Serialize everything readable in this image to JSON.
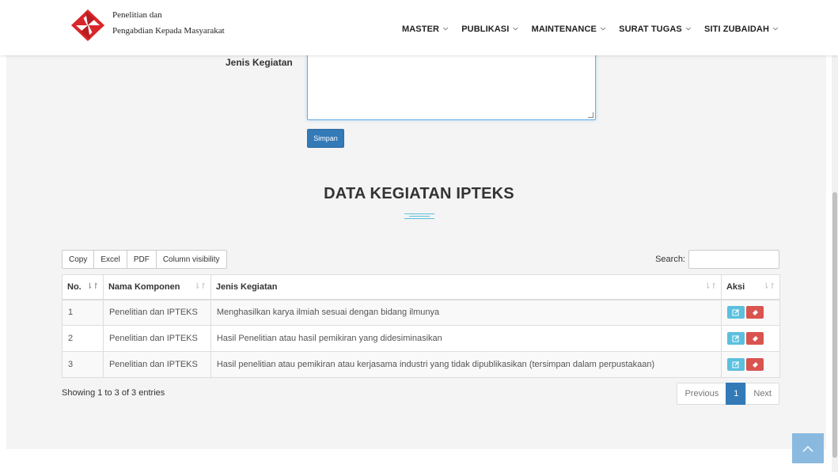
{
  "header": {
    "logo_line1": "Penelitian dan",
    "logo_line2": "Pengabdian Kepada Masyarakat",
    "nav": [
      {
        "label": "MASTER"
      },
      {
        "label": "PUBLIKASI"
      },
      {
        "label": "MAINTENANCE"
      },
      {
        "label": "SURAT TUGAS"
      },
      {
        "label": "SITI ZUBAIDAH"
      }
    ]
  },
  "form": {
    "jenis_label": "Jenis Kegiatan",
    "jenis_value": "",
    "submit_label": "Simpan"
  },
  "section": {
    "title": "DATA KEGIATAN IPTEKS"
  },
  "toolbar": {
    "buttons": [
      "Copy",
      "Excel",
      "PDF",
      "Column visibility"
    ],
    "search_label": "Search:",
    "search_value": ""
  },
  "table": {
    "headers": [
      "No.",
      "Nama Komponen",
      "Jenis Kegiatan",
      "Aksi"
    ],
    "rows": [
      {
        "no": "1",
        "komponen": "Penelitian dan IPTEKS",
        "jenis": "Menghasilkan karya ilmiah sesuai dengan bidang ilmunya"
      },
      {
        "no": "2",
        "komponen": "Penelitian dan IPTEKS",
        "jenis": "Hasil Penelitian atau hasil pemikiran yang didesiminasikan"
      },
      {
        "no": "3",
        "komponen": "Penelitian dan IPTEKS",
        "jenis": "Hasil penelitian atau pemikiran atau kerjasama industri yang tidak dipublikasikan (tersimpan dalam perpustakaan)"
      }
    ]
  },
  "footer": {
    "info": "Showing 1 to 3 of 3 entries",
    "prev": "Previous",
    "page": "1",
    "next": "Next"
  },
  "colors": {
    "primary": "#337ab7",
    "info": "#5bc0de",
    "danger": "#d9534f"
  },
  "icons": {
    "edit": "pencil-square-icon",
    "delete": "eraser-icon",
    "sort": "sort-icon",
    "back_to_top": "chevron-up-icon"
  }
}
